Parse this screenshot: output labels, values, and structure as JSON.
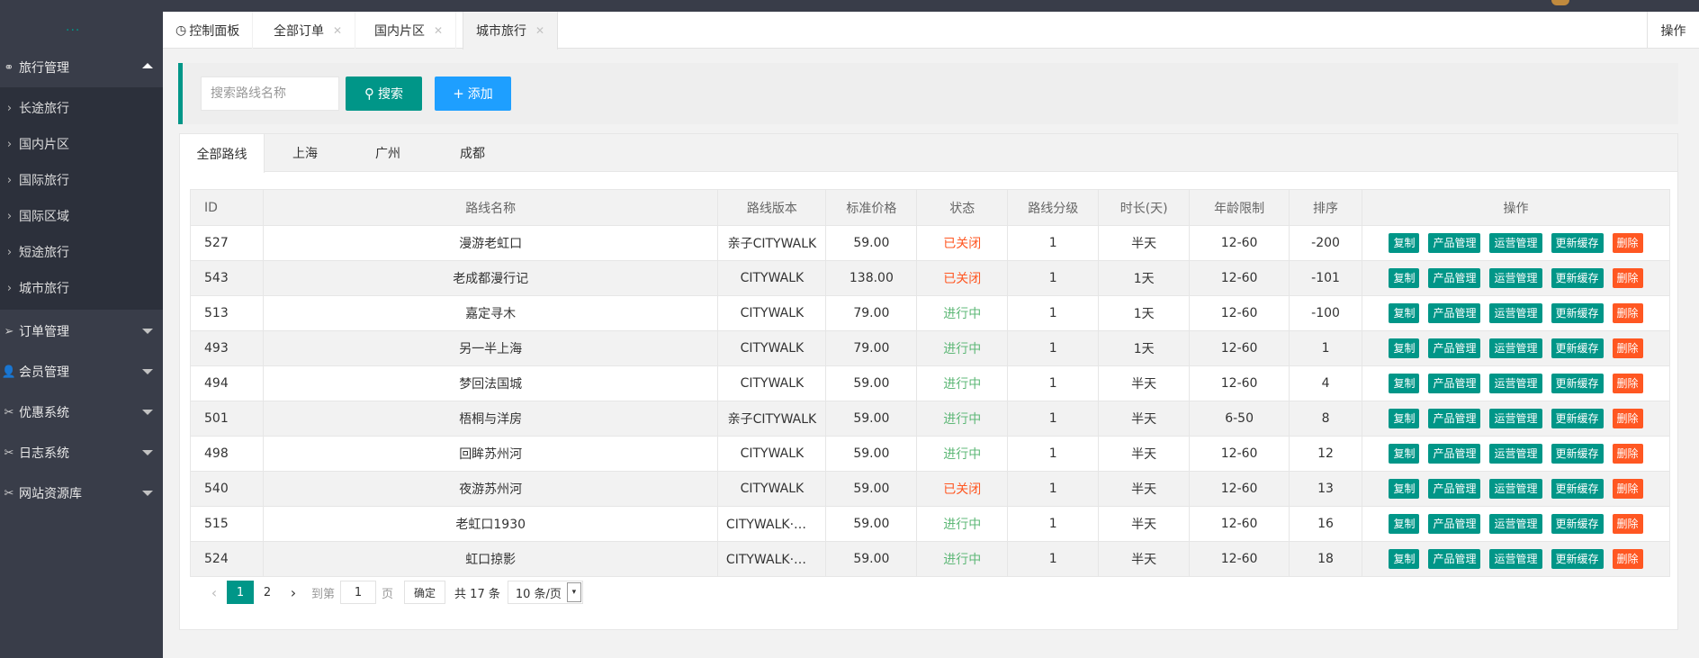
{
  "sidebar": {
    "dots": "···",
    "groups": [
      {
        "label": "旅行管理",
        "icon": "binoculars-icon",
        "glyph": "⚭",
        "expanded": true
      },
      {
        "label": "订单管理",
        "icon": "send-icon",
        "glyph": "➢"
      },
      {
        "label": "会员管理",
        "icon": "user-icon",
        "glyph": "👤"
      },
      {
        "label": "优惠系统",
        "icon": "tools-icon",
        "glyph": "✂"
      },
      {
        "label": "日志系统",
        "icon": "tools-icon",
        "glyph": "✂"
      },
      {
        "label": "网站资源库",
        "icon": "tools-icon",
        "glyph": "✂"
      }
    ],
    "items": [
      "长途旅行",
      "国内片区",
      "国际旅行",
      "国际区域",
      "短途旅行",
      "城市旅行"
    ],
    "chevron": "›"
  },
  "page_tabs": {
    "home": {
      "label": "控制面板",
      "icon": "dashboard-icon",
      "glyph": "◷"
    },
    "tabs": [
      {
        "label": "全部订单",
        "close": "✕"
      },
      {
        "label": "国内片区",
        "close": "✕"
      },
      {
        "label": "城市旅行",
        "close": "✕",
        "active": true
      }
    ],
    "ops_label": "操作"
  },
  "search": {
    "placeholder": "搜索路线名称",
    "value": "",
    "search_label": "搜索",
    "search_glyph": "⚲",
    "add_label": "添加",
    "add_glyph": "+"
  },
  "route_tabs": [
    "全部路线",
    "上海",
    "广州",
    "成都"
  ],
  "table": {
    "columns": [
      "ID",
      "路线名称",
      "路线版本",
      "标准价格",
      "状态",
      "路线分级",
      "时长(天)",
      "年龄限制",
      "排序",
      "操作"
    ],
    "actions": [
      "复制",
      "产品管理",
      "运营管理",
      "更新缓存",
      "删除"
    ],
    "rows": [
      {
        "id": "527",
        "name": "漫游老虹口",
        "version": "亲子CITYWALK",
        "price": "59.00",
        "status": "已关闭",
        "closed": true,
        "level": "1",
        "duration": "半天",
        "age": "12-60",
        "sort": "-200"
      },
      {
        "id": "543",
        "name": "老成都漫行记",
        "version": "CITYWALK",
        "price": "138.00",
        "status": "已关闭",
        "closed": true,
        "level": "1",
        "duration": "1天",
        "age": "12-60",
        "sort": "-101"
      },
      {
        "id": "513",
        "name": "嘉定寻木",
        "version": "CITYWALK",
        "price": "79.00",
        "status": "进行中",
        "closed": false,
        "level": "1",
        "duration": "1天",
        "age": "12-60",
        "sort": "-100"
      },
      {
        "id": "493",
        "name": "另一半上海",
        "version": "CITYWALK",
        "price": "79.00",
        "status": "进行中",
        "closed": false,
        "level": "1",
        "duration": "1天",
        "age": "12-60",
        "sort": "1"
      },
      {
        "id": "494",
        "name": "梦回法国城",
        "version": "CITYWALK",
        "price": "59.00",
        "status": "进行中",
        "closed": false,
        "level": "1",
        "duration": "半天",
        "age": "12-60",
        "sort": "4"
      },
      {
        "id": "501",
        "name": "梧桐与洋房",
        "version": "亲子CITYWALK",
        "price": "59.00",
        "status": "进行中",
        "closed": false,
        "level": "1",
        "duration": "半天",
        "age": "6-50",
        "sort": "8"
      },
      {
        "id": "498",
        "name": "回眸苏州河",
        "version": "CITYWALK",
        "price": "59.00",
        "status": "进行中",
        "closed": false,
        "level": "1",
        "duration": "半天",
        "age": "12-60",
        "sort": "12"
      },
      {
        "id": "540",
        "name": "夜游苏州河",
        "version": "CITYWALK",
        "price": "59.00",
        "status": "已关闭",
        "closed": true,
        "level": "1",
        "duration": "半天",
        "age": "12-60",
        "sort": "13"
      },
      {
        "id": "515",
        "name": "老虹口1930",
        "version": "CITYWALK·老虹口",
        "price": "59.00",
        "status": "进行中",
        "closed": false,
        "level": "1",
        "duration": "半天",
        "age": "12-60",
        "sort": "16"
      },
      {
        "id": "524",
        "name": "虹口掠影",
        "version": "CITYWALK·虹口",
        "price": "59.00",
        "status": "进行中",
        "closed": false,
        "level": "1",
        "duration": "半天",
        "age": "12-60",
        "sort": "18"
      }
    ]
  },
  "pagination": {
    "prev": "‹",
    "next": "›",
    "current": "1",
    "pages": [
      "2"
    ],
    "goto_label": "到第",
    "goto_value": "1",
    "page_unit": "页",
    "confirm": "确定",
    "total": "共 17 条",
    "page_size": "10 条/页",
    "dropdown_glyph": "▾"
  },
  "colors": {
    "sidebar": "#393d49",
    "accent": "#009688",
    "add": "#1e9fff",
    "danger": "#ff5722",
    "success": "#5fb878"
  }
}
